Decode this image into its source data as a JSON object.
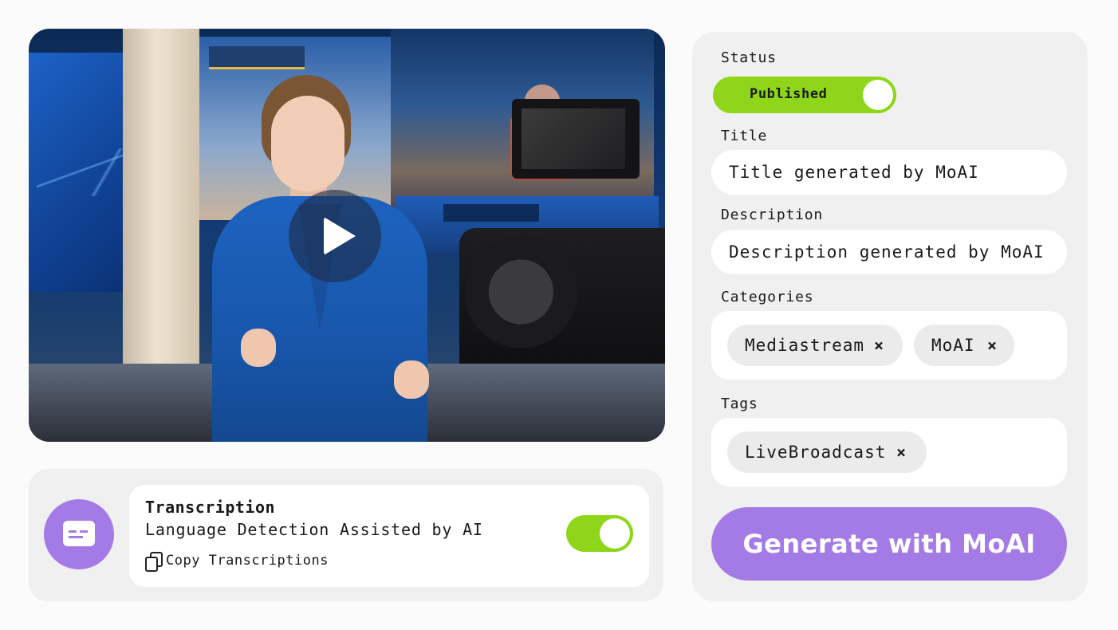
{
  "video": {
    "play_icon": "play-icon"
  },
  "transcription": {
    "icon": "closed-captions-icon",
    "title": "Transcription",
    "subtitle": "Language Detection Assisted by AI",
    "copy_label": "Copy Transcriptions",
    "copy_icon": "copy-icon",
    "enabled": true
  },
  "metadata": {
    "status_label": "Status",
    "status_value": "Published",
    "title_label": "Title",
    "title_value": "Title generated by MoAI",
    "description_label": "Description",
    "description_value": "Description generated by MoAI",
    "categories_label": "Categories",
    "categories": [
      {
        "label": "Mediastream",
        "remove": "×"
      },
      {
        "label": "MoAI",
        "remove": "×"
      }
    ],
    "tags_label": "Tags",
    "tags": [
      {
        "label": "LiveBroadcast",
        "remove": "×"
      }
    ],
    "generate_label": "Generate with MoAI"
  },
  "colors": {
    "accent_purple": "#a47be6",
    "toggle_green": "#8fd61a",
    "panel_bg": "#f0f0f0"
  }
}
